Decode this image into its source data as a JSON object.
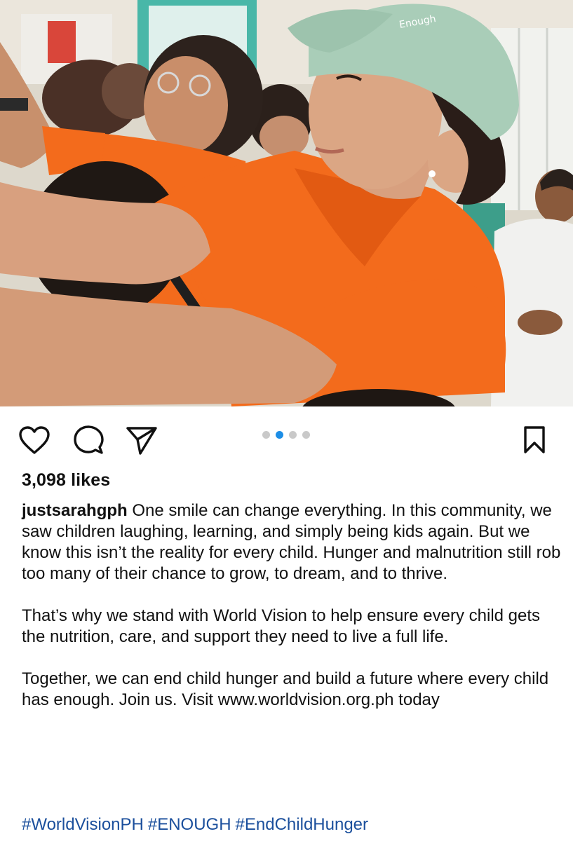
{
  "post": {
    "likes": "3,098 likes",
    "username": "justsarahgph",
    "caption_1": "One smile can change everything. In this community, we saw children laughing, learning, and simply being kids again. But we know this isn’t the reality for every child. Hunger and malnutrition still rob too many of their chance to grow, to dream, and to thrive.",
    "caption_2": "That’s why we stand with World Vision to help ensure every child gets the nutrition, care, and support they need to live a full life.",
    "caption_3": "Together, we can end child hunger and build a future where every child has enough. Join us. Visit www.worldvision.org.ph today",
    "hashtags": [
      "#WorldVisionPH",
      "#ENOUGH",
      "#EndChildHunger"
    ]
  },
  "carousel": {
    "total": 4,
    "active_index": 1
  },
  "icons": {
    "like": "heart-icon",
    "comment": "comment-bubble-icon",
    "share": "paper-plane-icon",
    "save": "bookmark-icon"
  },
  "colors": {
    "accent": "#1d8ee6",
    "hashtag": "#1b4f9c",
    "shirt_orange": "#f36b1c",
    "cap_mint": "#a9cdb8"
  }
}
